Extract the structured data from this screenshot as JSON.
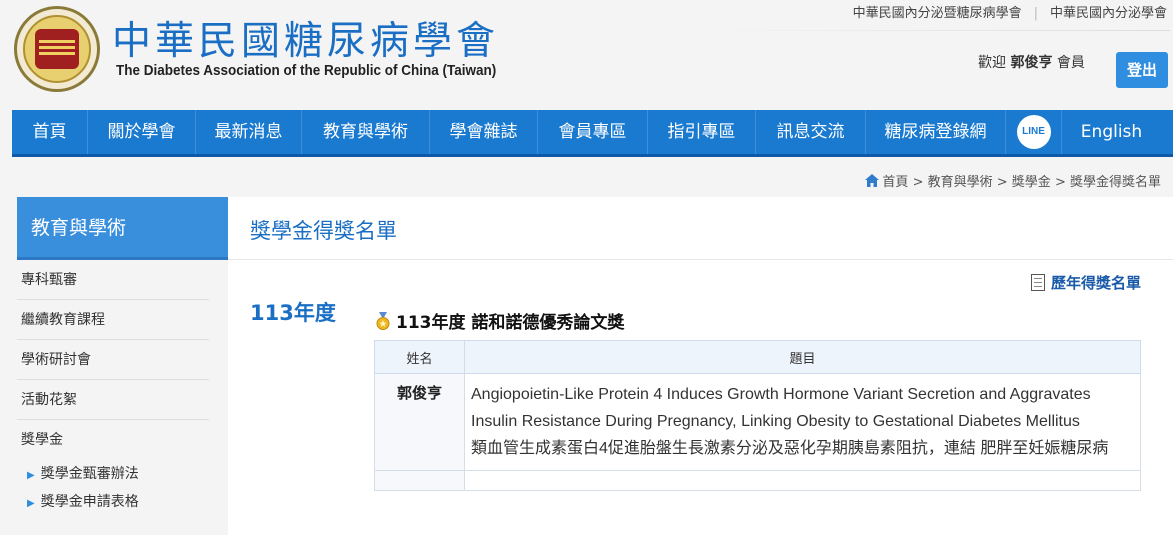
{
  "header": {
    "title_zh": "中華民國糖尿病學會",
    "title_en": "The Diabetes Association of the Republic of China (Taiwan)",
    "logo_text": "社團法人中華民國糖尿病學會",
    "top_links": [
      "中華民國內分泌暨糖尿病學會",
      "中華民國內分泌學會"
    ],
    "welcome_prefix": "歡迎",
    "user_name": "郭俊亨",
    "welcome_suffix": "會員",
    "logout_label": "登出"
  },
  "nav": {
    "items": [
      "首頁",
      "關於學會",
      "最新消息",
      "教育與學術",
      "學會雜誌",
      "會員專區",
      "指引專區",
      "訊息交流",
      "糖尿病登錄網"
    ],
    "line_label": "LINE",
    "english_label": "English"
  },
  "breadcrumb": [
    "首頁",
    "教育與學術",
    "獎學金",
    "獎學金得獎名單"
  ],
  "sidebar": {
    "heading": "教育與學術",
    "items": [
      "專科甄審",
      "繼續教育課程",
      "學術研討會",
      "活動花絮",
      "獎學金"
    ],
    "sub_items": [
      "獎學金甄審辦法",
      "獎學金申請表格"
    ]
  },
  "main": {
    "page_title": "獎學金得獎名單",
    "history_link": "歷年得獎名單",
    "year_label": "113年度",
    "award_title": "113年度 諾和諾德優秀論文獎",
    "table": {
      "headers": [
        "姓名",
        "題目"
      ],
      "rows": [
        {
          "name": "郭俊亨",
          "topic_en": "Angiopoietin-Like Protein 4 Induces Growth Hormone Variant Secretion and Aggravates Insulin Resistance During Pregnancy, Linking Obesity to Gestational Diabetes Mellitus",
          "topic_zh": "類血管生成素蛋白4促進胎盤生長激素分泌及惡化孕期胰島素阻抗，連結 肥胖至妊娠糖尿病"
        }
      ]
    }
  },
  "colors": {
    "brand_blue": "#1a7ad0",
    "title_blue": "#1a6fc4",
    "logout_blue": "#2f8ee0"
  }
}
